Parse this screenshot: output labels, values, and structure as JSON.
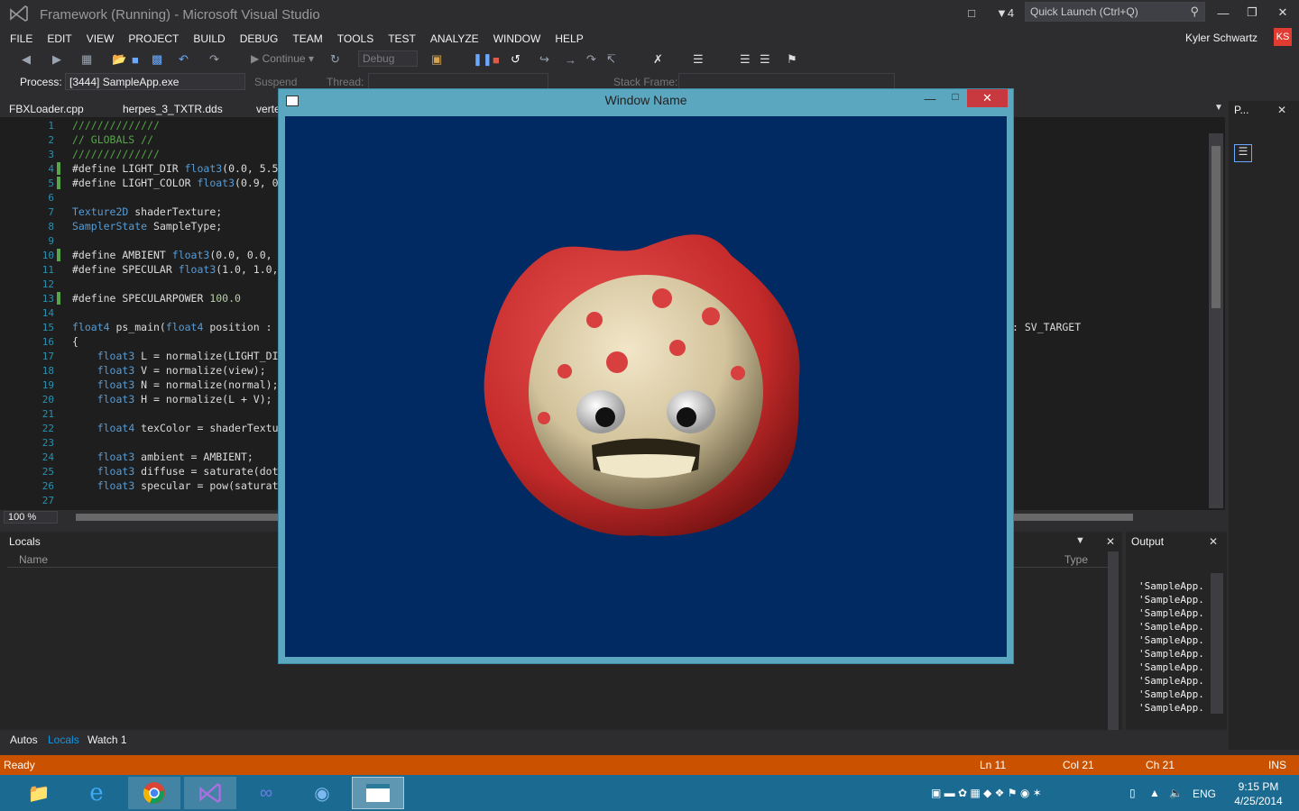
{
  "window": {
    "title": "Framework (Running) - Microsoft Visual Studio",
    "notifications": "4",
    "quick_launch_placeholder": "Quick Launch (Ctrl+Q)"
  },
  "menu": [
    "FILE",
    "EDIT",
    "VIEW",
    "PROJECT",
    "BUILD",
    "DEBUG",
    "TEAM",
    "TOOLS",
    "TEST",
    "ANALYZE",
    "WINDOW",
    "HELP"
  ],
  "user": {
    "name": "Kyler Schwartz",
    "initials": "KS"
  },
  "toolbar": {
    "continue_label": "Continue",
    "config": "Debug"
  },
  "process_bar": {
    "process_label": "Process:",
    "process_value": "[3444] SampleApp.exe",
    "suspend": "Suspend",
    "thread": "Thread:",
    "stack_frame": "Stack Frame:"
  },
  "tabs": [
    "FBXLoader.cpp",
    "herpes_3_TXTR.dds",
    "vertex"
  ],
  "right_panel_tab": "P...",
  "code": [
    {
      "n": "1",
      "t": "//////////////",
      "cls": "cmt"
    },
    {
      "n": "2",
      "t": "// GLOBALS //",
      "cls": "cmt"
    },
    {
      "n": "3",
      "t": "//////////////",
      "cls": "cmt"
    },
    {
      "n": "4",
      "t": "#define LIGHT_DIR float3(0.0, 5.5",
      "chg": true
    },
    {
      "n": "5",
      "t": "#define LIGHT_COLOR float3(0.9, 0",
      "chg": true
    },
    {
      "n": "6",
      "t": ""
    },
    {
      "n": "7",
      "t": "Texture2D shaderTexture;"
    },
    {
      "n": "8",
      "t": "SamplerState SampleType;"
    },
    {
      "n": "9",
      "t": ""
    },
    {
      "n": "10",
      "t": "#define AMBIENT float3(0.0, 0.0,",
      "chg": true
    },
    {
      "n": "11",
      "t": "#define SPECULAR float3(1.0, 1.0,"
    },
    {
      "n": "12",
      "t": ""
    },
    {
      "n": "13",
      "t": "#define SPECULARPOWER 100.0",
      "chg": true
    },
    {
      "n": "14",
      "t": ""
    },
    {
      "n": "15",
      "t": "float4 ps_main(float4 position :"
    },
    {
      "n": "16",
      "t": "{"
    },
    {
      "n": "17",
      "t": "    float3 L = normalize(LIGHT_DI"
    },
    {
      "n": "18",
      "t": "    float3 V = normalize(view);"
    },
    {
      "n": "19",
      "t": "    float3 N = normalize(normal);"
    },
    {
      "n": "20",
      "t": "    float3 H = normalize(L + V);"
    },
    {
      "n": "21",
      "t": ""
    },
    {
      "n": "22",
      "t": "    float4 texColor = shaderTextu"
    },
    {
      "n": "23",
      "t": ""
    },
    {
      "n": "24",
      "t": "    float3 ambient = AMBIENT;"
    },
    {
      "n": "25",
      "t": "    float3 diffuse = saturate(dot"
    },
    {
      "n": "26",
      "t": "    float3 specular = pow(saturat"
    },
    {
      "n": "27",
      "t": ""
    }
  ],
  "code_suffix_line15": ": SV_TARGET",
  "zoom": "100 %",
  "locals": {
    "title": "Locals",
    "col_name": "Name",
    "col_type": "Type"
  },
  "output": {
    "title": "Output",
    "lines": [
      "'SampleApp.",
      "'SampleApp.",
      "'SampleApp.",
      "'SampleApp.",
      "'SampleApp.",
      "'SampleApp.",
      "'SampleApp.",
      "'SampleApp.",
      "'SampleApp.",
      "'SampleApp."
    ]
  },
  "bottom_tabs": [
    "Autos",
    "Locals",
    "Watch 1"
  ],
  "status": {
    "ready": "Ready",
    "ln": "Ln 11",
    "col": "Col 21",
    "ch": "Ch 21",
    "mode": "INS"
  },
  "app_window": {
    "title": "Window Name"
  },
  "taskbar": {
    "lang": "ENG",
    "time": "9:15 PM",
    "date": "4/25/2014"
  },
  "colors": {
    "status_bar": "#ca5100",
    "taskbar": "#1a6a91",
    "viewport": "#002a61",
    "close": "#c7383f"
  }
}
